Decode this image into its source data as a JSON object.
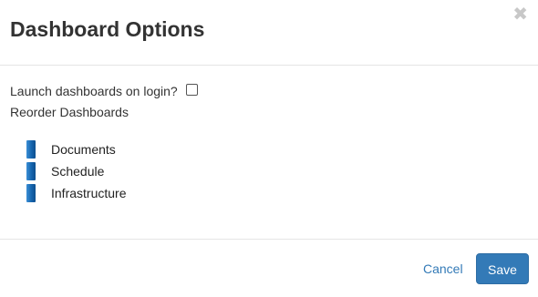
{
  "modal": {
    "title": "Dashboard Options",
    "close_glyph": "✖"
  },
  "body": {
    "launch_label": "Launch dashboards on login?",
    "launch_checked": false,
    "reorder_label": "Reorder Dashboards",
    "dashboards": [
      {
        "label": "Documents",
        "handle_icon": "drag-handle-icon"
      },
      {
        "label": "Schedule",
        "handle_icon": "drag-handle-icon"
      },
      {
        "label": "Infrastructure",
        "handle_icon": "drag-handle-icon"
      }
    ]
  },
  "footer": {
    "cancel_label": "Cancel",
    "save_label": "Save"
  },
  "colors": {
    "primary": "#337ab7",
    "handle": "#1565ae",
    "close_icon": "#c8c8c8"
  }
}
